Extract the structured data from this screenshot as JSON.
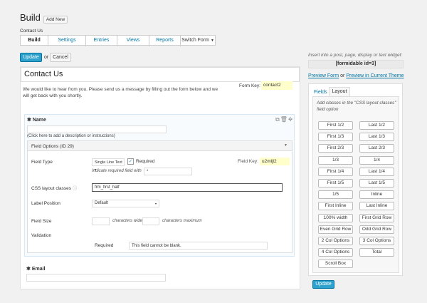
{
  "page": {
    "title": "Build",
    "add_new": "Add New",
    "form_name": "Contact Us"
  },
  "tabs": [
    "Build",
    "Settings",
    "Entries",
    "Views",
    "Reports"
  ],
  "switch_form": "Switch Form",
  "actions": {
    "update": "Update",
    "or": "or",
    "cancel": "Cancel"
  },
  "form": {
    "title": "Contact Us",
    "description": "We would like to hear from you. Please send us a message by filling out the form below and we will get back with you shortly.",
    "form_key_label": "Form Key:",
    "form_key_value": "contact2"
  },
  "field_name": {
    "label": "Name",
    "hint": "(Click here to add a description or instructions)",
    "options_title": "Field Options (ID 29)",
    "field_type_label": "Field Type",
    "field_type_value": "Single Line Text",
    "required_label": "Required",
    "required_indicator_label": "Indicate required field with",
    "required_indicator_value": "*",
    "field_key_label": "Field Key:",
    "field_key_value": "u2mljl2",
    "css_label": "CSS layout classes",
    "css_value": "frm_first_half",
    "label_position_label": "Label Position",
    "label_position_value": "Default",
    "field_size_label": "Field Size",
    "chars_wide": "characters wide",
    "chars_max": "characters maximum",
    "validation_label": "Validation",
    "validation_required": "Required",
    "validation_message": "This field cannot be blank."
  },
  "field_email": {
    "label": "Email"
  },
  "sidebar": {
    "insert_note": "Insert into a post, page, display or text widget:",
    "shortcode": "[formidable id=3]",
    "preview_form": "Preview Form",
    "or": "or",
    "preview_theme": "Preview in Current Theme",
    "tab_fields": "Fields",
    "tab_layout": "Layout",
    "layout_hint": "Add classes in the \"CSS layout classes\" field option",
    "layout_buttons": [
      "First 1/2",
      "Last 1/2",
      "First 1/3",
      "Last 1/3",
      "First 2/3",
      "Last 2/3",
      "1/3",
      "1/4",
      "First 1/4",
      "Last 1/4",
      "First 1/5",
      "Last 1/5",
      "1/5",
      "Inline",
      "First Inline",
      "Last Inline",
      "100% width",
      "First Grid Row",
      "Even Grid Row",
      "Odd Grid Row",
      "2 Col Options",
      "3 Col Options",
      "4 Col Options",
      "Total",
      "Scroll Box"
    ],
    "update": "Update"
  },
  "colors": {
    "accent": "#2ea2cc",
    "link": "#0074a2",
    "highlight": "#ffffcc",
    "selected_border": "#d6e7f5"
  }
}
